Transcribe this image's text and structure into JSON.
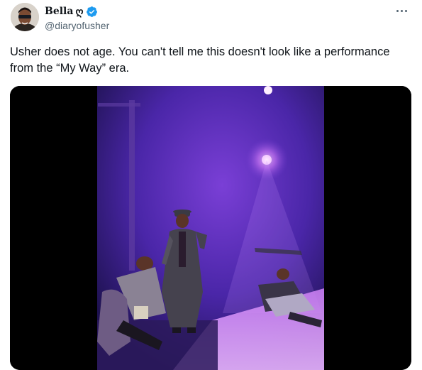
{
  "author": {
    "display_name": "Bella",
    "name_glyph": "ღ",
    "handle": "@diaryofusher",
    "verified": true,
    "verified_color": "#1d9bf0"
  },
  "tweet": {
    "text": "Usher does not age. You can't tell me this doesn't look like a performance from the “My Way” era."
  },
  "media": {
    "type": "video-still",
    "description_colors": {
      "stage": "#5a2fb8",
      "light": "#f0c8ff"
    }
  },
  "icons": {
    "more": "more-horizontal-icon",
    "verified": "verified-badge-icon"
  }
}
